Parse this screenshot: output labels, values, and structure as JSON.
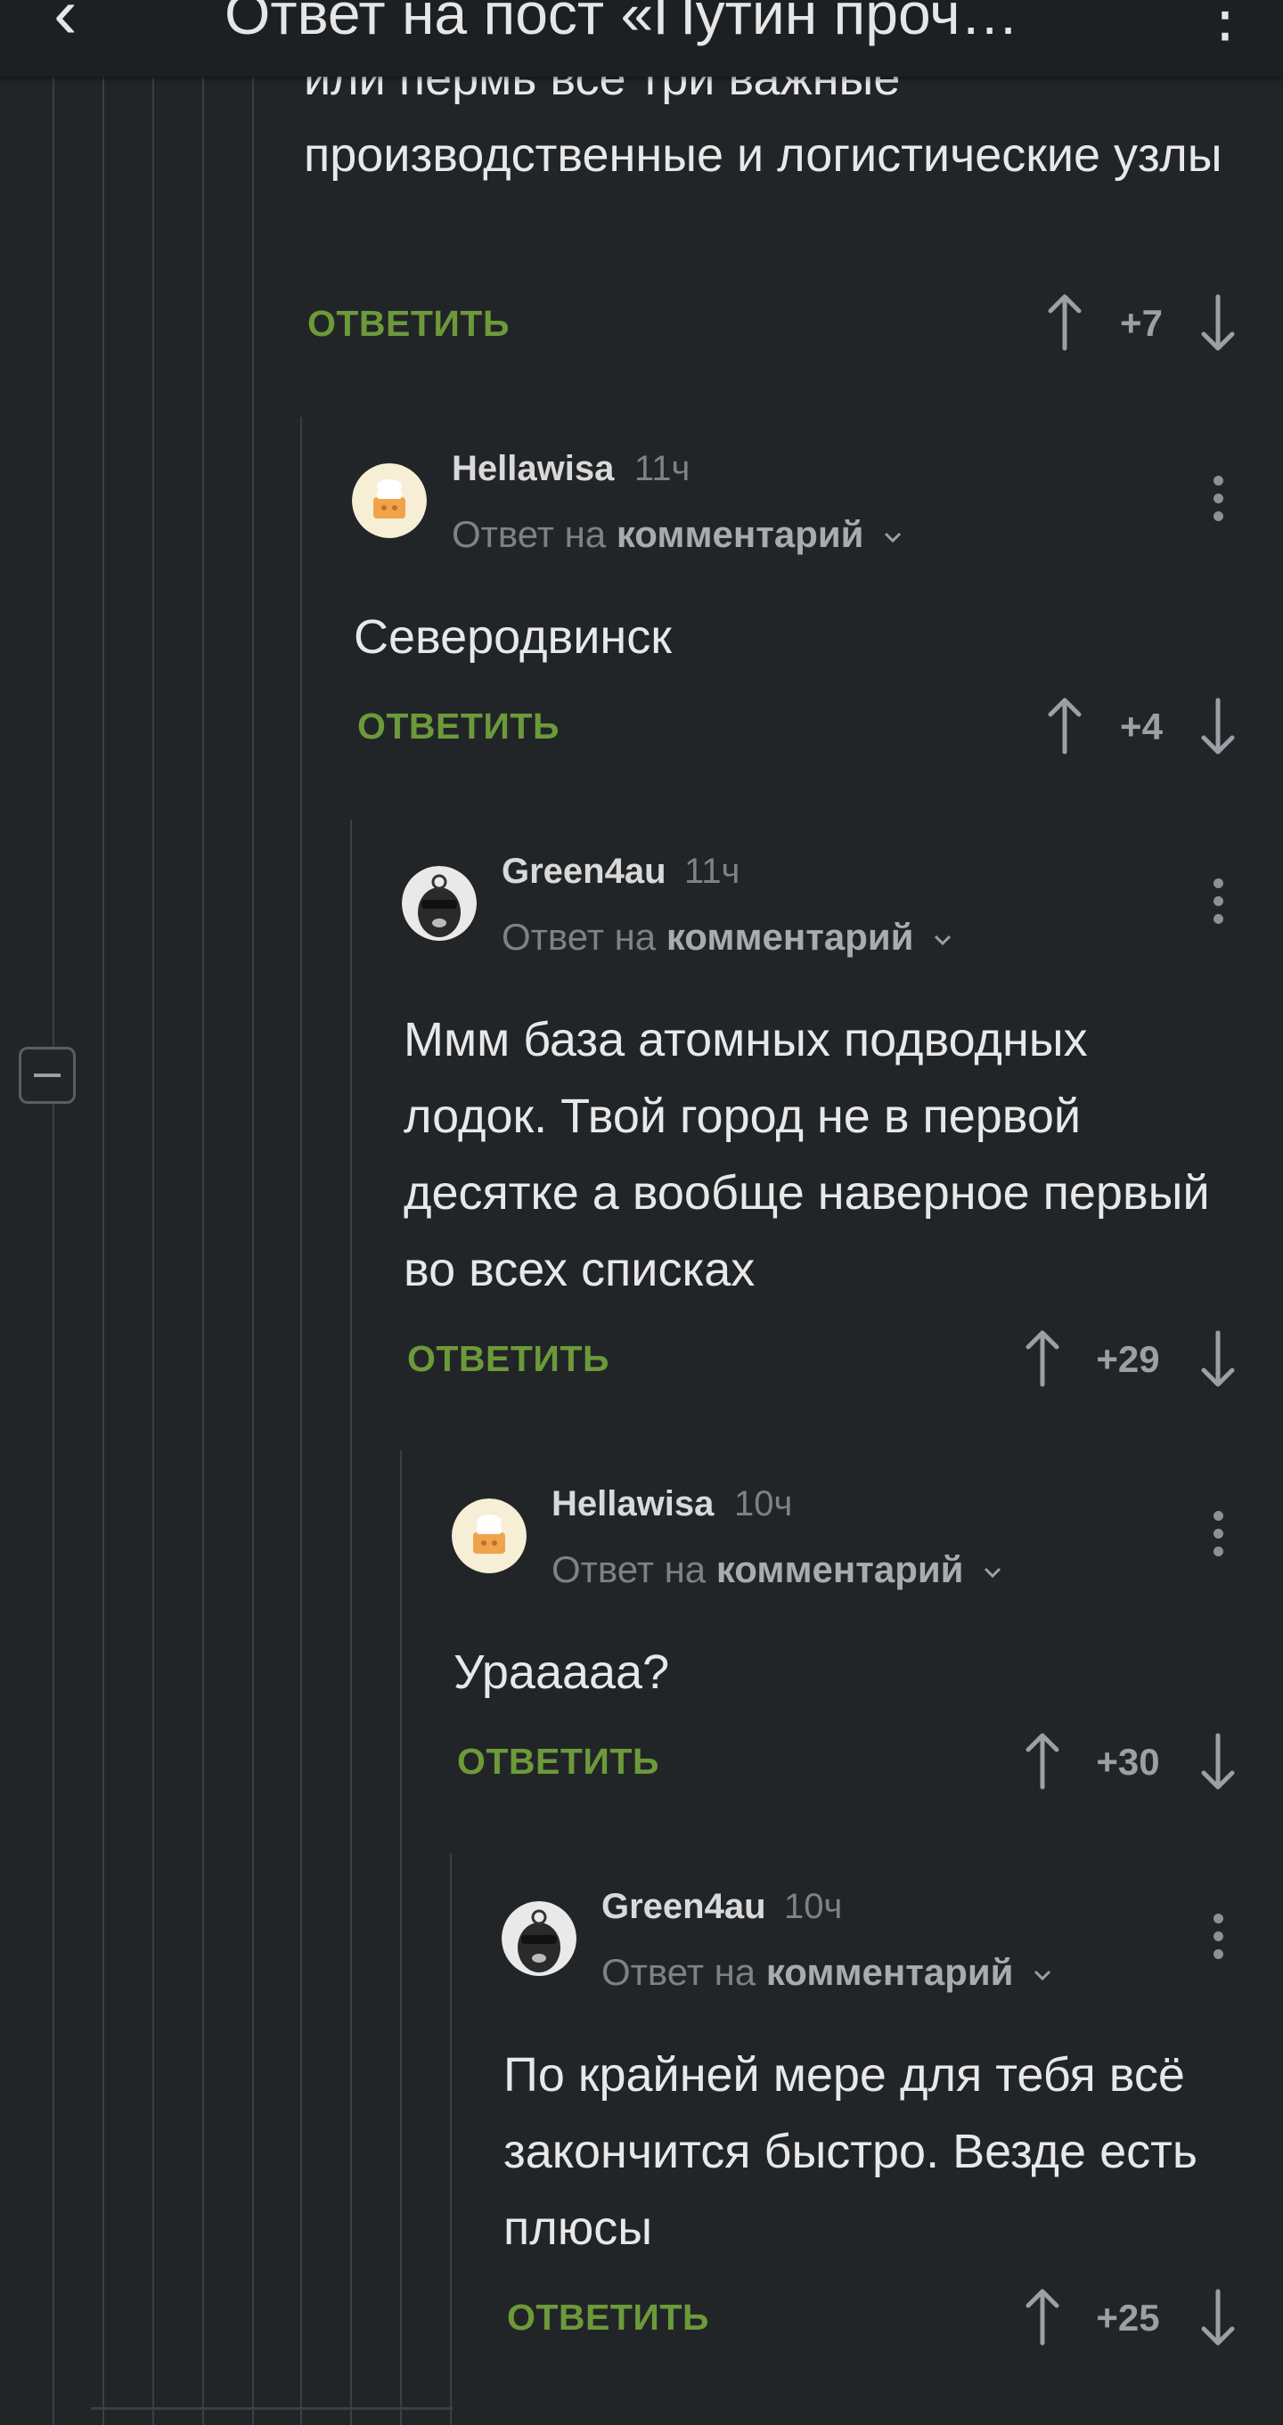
{
  "header": {
    "title": "Ответ на пост «Путин проч…"
  },
  "comments": [
    {
      "text": "или пермь все три важные производственные и логистические узлы",
      "reply_label": "ОТВЕТИТЬ",
      "score": "+7"
    },
    {
      "username": "Hellawisa",
      "time": "11ч",
      "reply_prefix": "Ответ на",
      "reply_target": "комментарий",
      "text": "Северодвинск",
      "reply_label": "ОТВЕТИТЬ",
      "score": "+4"
    },
    {
      "username": "Green4au",
      "time": "11ч",
      "reply_prefix": "Ответ на",
      "reply_target": "комментарий",
      "text": "Ммм база атомных подводных лодок. Твой город не в первой десятке а вообще наверное первый во всех списках",
      "reply_label": "ОТВЕТИТЬ",
      "score": "+29"
    },
    {
      "username": "Hellawisa",
      "time": "10ч",
      "reply_prefix": "Ответ на",
      "reply_target": "комментарий",
      "text": "Урааааа?",
      "reply_label": "ОТВЕТИТЬ",
      "score": "+30"
    },
    {
      "username": "Green4au",
      "time": "10ч",
      "reply_prefix": "Ответ на",
      "reply_target": "комментарий",
      "text": "По крайней мере для тебя всё закончится быстро. Везде есть плюсы",
      "reply_label": "ОТВЕТИТЬ",
      "score": "+25"
    }
  ]
}
